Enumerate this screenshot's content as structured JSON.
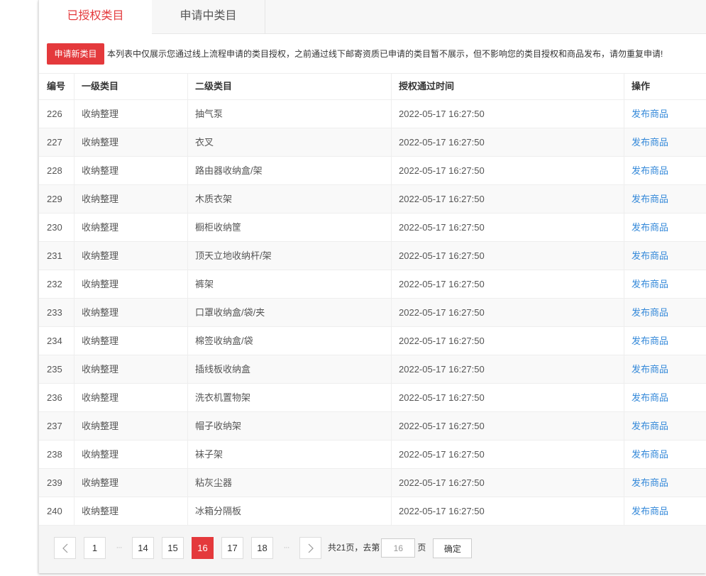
{
  "tabs": [
    {
      "label": "已授权类目",
      "active": true
    },
    {
      "label": "申请中类目",
      "active": false
    }
  ],
  "notice": {
    "button_label": "申请新类目",
    "text": "本列表中仅展示您通过线上流程申请的类目授权，之前通过线下邮寄资质已申请的类目暂不展示，但不影响您的类目授权和商品发布，请勿重复申请!"
  },
  "table": {
    "headers": {
      "id": "编号",
      "level1": "一级类目",
      "level2": "二级类目",
      "time": "授权通过时间",
      "action": "操作"
    },
    "rows": [
      {
        "id": "226",
        "level1": "收纳整理",
        "level2": "抽气泵",
        "time": "2022-05-17 16:27:50",
        "action": "发布商品"
      },
      {
        "id": "227",
        "level1": "收纳整理",
        "level2": "衣叉",
        "time": "2022-05-17 16:27:50",
        "action": "发布商品"
      },
      {
        "id": "228",
        "level1": "收纳整理",
        "level2": "路由器收纳盒/架",
        "time": "2022-05-17 16:27:50",
        "action": "发布商品"
      },
      {
        "id": "229",
        "level1": "收纳整理",
        "level2": "木质衣架",
        "time": "2022-05-17 16:27:50",
        "action": "发布商品"
      },
      {
        "id": "230",
        "level1": "收纳整理",
        "level2": "橱柜收纳筐",
        "time": "2022-05-17 16:27:50",
        "action": "发布商品"
      },
      {
        "id": "231",
        "level1": "收纳整理",
        "level2": "顶天立地收纳杆/架",
        "time": "2022-05-17 16:27:50",
        "action": "发布商品"
      },
      {
        "id": "232",
        "level1": "收纳整理",
        "level2": "裤架",
        "time": "2022-05-17 16:27:50",
        "action": "发布商品"
      },
      {
        "id": "233",
        "level1": "收纳整理",
        "level2": "口罩收纳盒/袋/夹",
        "time": "2022-05-17 16:27:50",
        "action": "发布商品"
      },
      {
        "id": "234",
        "level1": "收纳整理",
        "level2": "棉签收纳盒/袋",
        "time": "2022-05-17 16:27:50",
        "action": "发布商品"
      },
      {
        "id": "235",
        "level1": "收纳整理",
        "level2": "插线板收纳盒",
        "time": "2022-05-17 16:27:50",
        "action": "发布商品"
      },
      {
        "id": "236",
        "level1": "收纳整理",
        "level2": "洗衣机置物架",
        "time": "2022-05-17 16:27:50",
        "action": "发布商品"
      },
      {
        "id": "237",
        "level1": "收纳整理",
        "level2": "帽子收纳架",
        "time": "2022-05-17 16:27:50",
        "action": "发布商品"
      },
      {
        "id": "238",
        "level1": "收纳整理",
        "level2": "袜子架",
        "time": "2022-05-17 16:27:50",
        "action": "发布商品"
      },
      {
        "id": "239",
        "level1": "收纳整理",
        "level2": "粘灰尘器",
        "time": "2022-05-17 16:27:50",
        "action": "发布商品"
      },
      {
        "id": "240",
        "level1": "收纳整理",
        "level2": "冰箱分隔板",
        "time": "2022-05-17 16:27:50",
        "action": "发布商品"
      }
    ]
  },
  "pagination": {
    "prev_icon": "chevron-left-icon",
    "next_icon": "chevron-right-icon",
    "ellipsis": "···",
    "pages": [
      {
        "label": "1",
        "active": false
      },
      {
        "label": "14",
        "active": false
      },
      {
        "label": "15",
        "active": false
      },
      {
        "label": "16",
        "active": true
      },
      {
        "label": "17",
        "active": false
      },
      {
        "label": "18",
        "active": false
      }
    ],
    "total_text": "共21页，去第",
    "goto_value": "16",
    "page_suffix": "页",
    "confirm_label": "确定"
  },
  "colors": {
    "accent": "#e4393c",
    "link": "#3388d9"
  }
}
